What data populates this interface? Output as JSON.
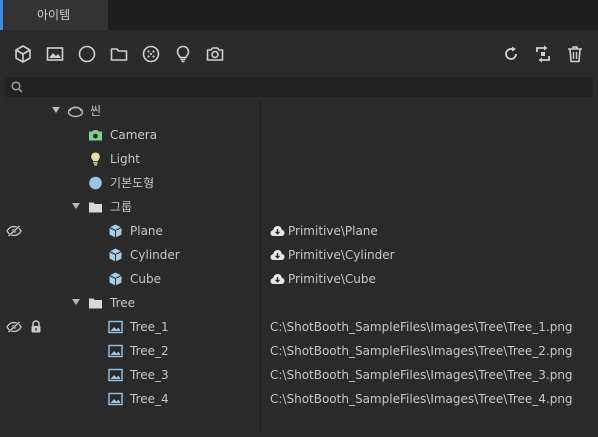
{
  "tab": {
    "label": "아이템"
  },
  "toolbar": {
    "left": [
      "cube-icon",
      "image-icon",
      "circle-icon",
      "folder-icon",
      "particles-icon",
      "lightbulb-icon",
      "camera-icon"
    ],
    "right": [
      "refresh-icon",
      "sync-icon",
      "trash-icon"
    ]
  },
  "search": {
    "placeholder": "",
    "value": ""
  },
  "tree": {
    "scene": {
      "label": "씬",
      "icon": "scene-icon",
      "expanded": true
    },
    "camera": {
      "label": "Camera",
      "icon": "camera-icon"
    },
    "light": {
      "label": "Light",
      "icon": "lightbulb-icon"
    },
    "primitive": {
      "label": "기본도형",
      "icon": "sphere-icon"
    },
    "group": {
      "label": "그룹",
      "icon": "folder-icon",
      "expanded": true
    },
    "plane": {
      "label": "Plane",
      "icon": "cube-icon",
      "hidden": true,
      "path": "Primitive\\Plane"
    },
    "cylinder": {
      "label": "Cylinder",
      "icon": "cube-icon",
      "path": "Primitive\\Cylinder"
    },
    "cube": {
      "label": "Cube",
      "icon": "cube-icon",
      "path": "Primitive\\Cube"
    },
    "tree_folder": {
      "label": "Tree",
      "icon": "folder-icon",
      "expanded": true
    },
    "tree1": {
      "label": "Tree_1",
      "icon": "image-icon",
      "hidden": true,
      "locked": true,
      "path": "C:\\ShotBooth_SampleFiles\\Images\\Tree\\Tree_1.png"
    },
    "tree2": {
      "label": "Tree_2",
      "icon": "image-icon",
      "path": "C:\\ShotBooth_SampleFiles\\Images\\Tree\\Tree_2.png"
    },
    "tree3": {
      "label": "Tree_3",
      "icon": "image-icon",
      "path": "C:\\ShotBooth_SampleFiles\\Images\\Tree\\Tree_3.png"
    },
    "tree4": {
      "label": "Tree_4",
      "icon": "image-icon",
      "path": "C:\\ShotBooth_SampleFiles\\Images\\Tree\\Tree_4.png"
    }
  },
  "colors": {
    "accent": "#3b8ce4",
    "camera_icon": "#7fd08a",
    "light_icon": "#e8dfa0",
    "primitive_icon": "#9cc4e4",
    "cube_icon": "#a8cde8",
    "image_icon": "#9cc4e4"
  }
}
